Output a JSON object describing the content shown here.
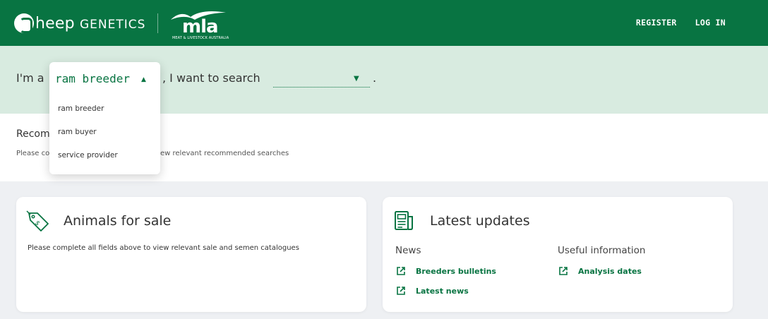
{
  "header": {
    "brand_letter_rest": "heep ",
    "brand_caps": "GENETICS",
    "partner_logo_word": "mla",
    "partner_logo_sub": "MEAT & LIVESTOCK AUSTRALIA",
    "nav": {
      "register": "REGISTER",
      "login": "LOG IN"
    },
    "brand_color": "#087442"
  },
  "search": {
    "prefix": "I'm a",
    "mid": ", I want to search",
    "suffix": ".",
    "role_selected": "ram breeder",
    "role_options": [
      "ram breeder",
      "ram buyer",
      "service provider"
    ],
    "target_value": ""
  },
  "recommended": {
    "title": "Recom",
    "desc_left": "Please co",
    "desc_right": "ew relevant recommended searches"
  },
  "animals": {
    "title": "Animals for sale",
    "desc": "Please complete all fields above to view relevant sale and semen catalogues"
  },
  "updates": {
    "title": "Latest updates",
    "news_heading": "News",
    "useful_heading": "Useful information",
    "news_links": [
      "Breeders bulletins",
      "Latest news"
    ],
    "useful_links": [
      "Analysis dates"
    ]
  }
}
